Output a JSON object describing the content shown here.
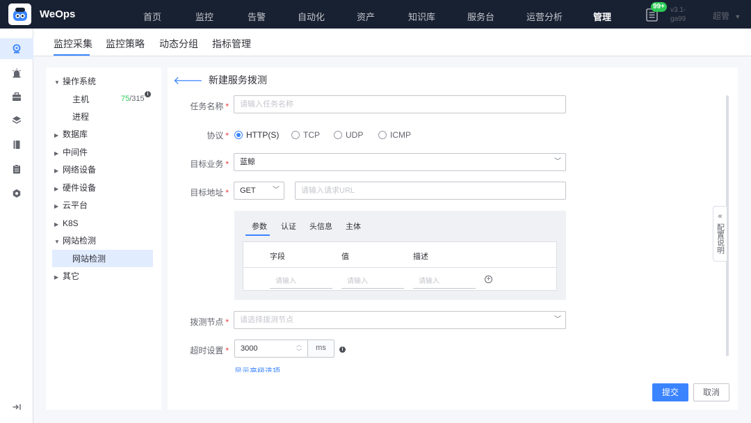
{
  "brand": "WeOps",
  "nav": [
    "首页",
    "监控",
    "告警",
    "自动化",
    "资产",
    "知识库",
    "服务台",
    "运营分析",
    "管理"
  ],
  "notification_badge": "99+",
  "version": "v3.1-ga99",
  "user": "超管",
  "tabs": [
    "监控采集",
    "监控策略",
    "动态分组",
    "指标管理"
  ],
  "tree": {
    "os": "操作系统",
    "host": "主机",
    "host_ok": "75",
    "host_total": "/315",
    "process": "进程",
    "database": "数据库",
    "middleware": "中间件",
    "network": "网络设备",
    "hardware": "硬件设备",
    "cloud": "云平台",
    "k8s": "K8S",
    "website": "网站检测",
    "website_child": "网站检测",
    "other": "其它"
  },
  "form": {
    "title": "新建服务拨测",
    "task_name_label": "任务名称",
    "task_name_placeholder": "请输入任务名称",
    "protocol_label": "协议",
    "protocols": [
      "HTTP(S)",
      "TCP",
      "UDP",
      "ICMP"
    ],
    "selected_protocol": "HTTP(S)",
    "target_business_label": "目标业务",
    "target_business_value": "蓝鲸",
    "target_address_label": "目标地址",
    "method": "GET",
    "url_placeholder": "请输入请求URL",
    "sub_tabs": [
      "参数",
      "认证",
      "头信息",
      "主体"
    ],
    "columns": [
      "字段",
      "值",
      "描述"
    ],
    "cell_placeholder": "请输入",
    "node_label": "拨测节点",
    "node_placeholder": "请选择拨测节点",
    "timeout_label": "超时设置",
    "timeout_value": "3000",
    "timeout_unit": "ms",
    "advanced_link": "显示高级选项",
    "submit": "提交",
    "cancel": "取消"
  },
  "side_tip": "配置说明",
  "colors": {
    "primary": "#3a84ff",
    "topbar": "#182132",
    "success": "#2dcb56",
    "required": "#ea3636"
  }
}
